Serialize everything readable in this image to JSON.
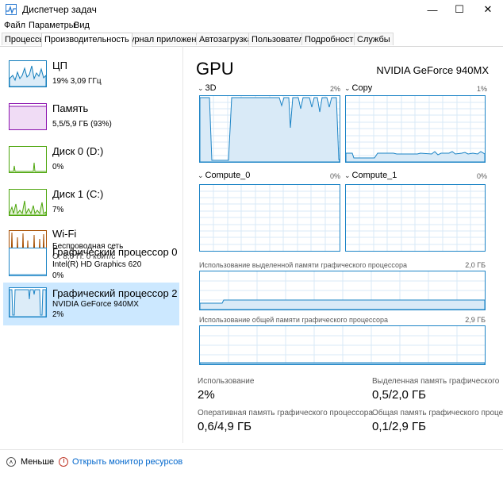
{
  "window": {
    "title": "Диспетчер задач",
    "minimize": "—",
    "maximize": "☐",
    "close": "✕"
  },
  "menu": [
    "Файл",
    "Параметры",
    "Вид"
  ],
  "tabs": [
    "Процессы",
    "Производительность",
    "Журнал приложений",
    "Автозагрузка",
    "Пользователи",
    "Подробности",
    "Службы"
  ],
  "active_tab": "Производительность",
  "resources": [
    {
      "name": "ЦП",
      "line1": "19% 3,09 ГГц",
      "line2": "",
      "color": "#117dbb"
    },
    {
      "name": "Память",
      "line1": "5,5/5,9 ГБ (93%)",
      "line2": "",
      "color": "#8b12ae"
    },
    {
      "name": "Диск 0 (D:)",
      "line1": "0%",
      "line2": "",
      "color": "#4da60c"
    },
    {
      "name": "Диск 1 (C:)",
      "line1": "7%",
      "line2": "",
      "color": "#4da60c"
    },
    {
      "name": "Wi-Fi",
      "line1": "Беспроводная сеть",
      "line2": "О: 8,0  П: 0 кбит/с",
      "color": "#a74f01"
    },
    {
      "name": "Графический процессор 0",
      "line1": "Intel(R) HD Graphics 620",
      "line2": "0%",
      "color": "#1c84c6"
    },
    {
      "name": "Графический процессор 2",
      "line1": "NVIDIA GeForce 940MX",
      "line2": "2%",
      "color": "#1c84c6"
    }
  ],
  "gpu": {
    "title": "GPU",
    "model": "NVIDIA GeForce 940MX",
    "engines": [
      {
        "name": "3D",
        "percent": "2%"
      },
      {
        "name": "Copy",
        "percent": "1%"
      },
      {
        "name": "Compute_0",
        "percent": "0%"
      },
      {
        "name": "Compute_1",
        "percent": "0%"
      }
    ],
    "dedicated_label": "Использование выделенной памяти графического процессора",
    "dedicated_max": "2,0 ГБ",
    "shared_label": "Использование общей памяти графического процессора",
    "shared_max": "2,9 ГБ",
    "stats": [
      {
        "label": "Использование",
        "value": "2%"
      },
      {
        "label": "Выделенная память графического",
        "value": "0,5/2,0 ГБ"
      },
      {
        "label": "Оперативная память графического процессора",
        "value": "0,6/4,9 ГБ"
      },
      {
        "label": "Общая память графического проце",
        "value": "0,1/2,9 ГБ"
      }
    ]
  },
  "footer": {
    "less": "Меньше",
    "monitor": "Открыть монитор ресурсов"
  },
  "colors": {
    "accent": "#1c84c6",
    "selected_bg": "#cce8ff",
    "link": "#0066cc"
  }
}
